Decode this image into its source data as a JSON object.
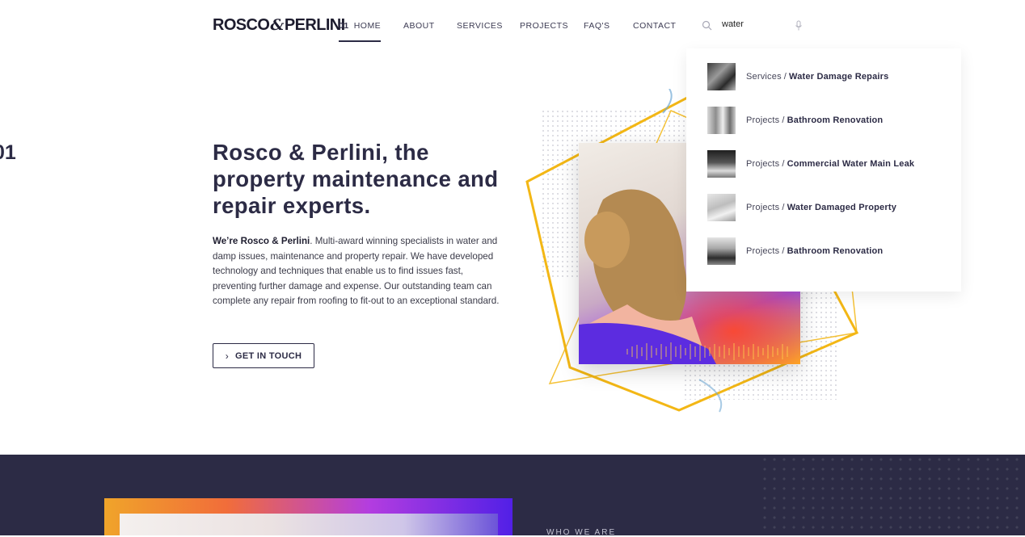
{
  "brand": {
    "logo_left": "ROSCO",
    "logo_amp": "&",
    "logo_right": "PERLINI"
  },
  "nav": [
    {
      "num": "01",
      "label": "HOME",
      "active": true
    },
    {
      "label": "ABOUT"
    },
    {
      "label": "SERVICES"
    },
    {
      "label": "PROJECTS"
    },
    {
      "label": "FAQ'S"
    },
    {
      "label": "CONTACT"
    }
  ],
  "search": {
    "value": "water",
    "icon": "search-icon",
    "mic_icon": "microphone-icon"
  },
  "search_results": [
    {
      "category": "Services",
      "separator": "/",
      "title": "Water Damage Repairs"
    },
    {
      "category": "Projects",
      "separator": "/",
      "title": "Bathroom Renovation"
    },
    {
      "category": "Projects",
      "separator": "/",
      "title": "Commercial Water Main Leak"
    },
    {
      "category": "Projects",
      "separator": "/",
      "title": "Water Damaged Property"
    },
    {
      "category": "Projects",
      "separator": "/",
      "title": "Bathroom Renovation"
    }
  ],
  "slide": {
    "number": "01"
  },
  "hero": {
    "title": "Rosco & Perlini, the property maintenance and repair experts.",
    "body_strong": "We’re Rosco & Perlini",
    "body": ". Multi-award winning specialists in water and damp issues, maintenance and property repair. We have developed technology and techniques that enable us to find issues fast, preventing further damage and expense. Our outstanding team can complete any repair from roofing to fit-out to an exceptional standard.",
    "cta_label": "GET IN TOUCH"
  },
  "about": {
    "label": "WHO WE ARE"
  },
  "colors": {
    "navy": "#2c2b45",
    "accent_yellow": "#f3b715",
    "gradient_purple": "#5b2de0",
    "gradient_orange": "#ff7a2a"
  }
}
